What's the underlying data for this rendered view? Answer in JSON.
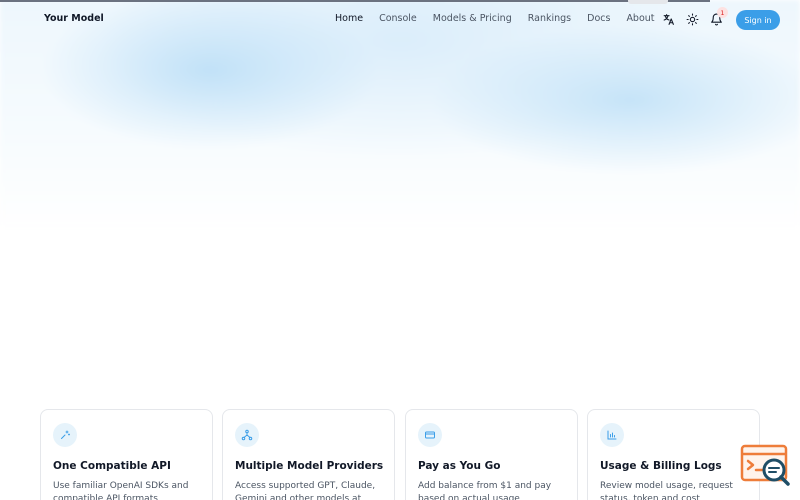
{
  "brand": "Your Model",
  "nav": {
    "items": [
      "Home",
      "Console",
      "Models & Pricing",
      "Rankings",
      "Docs",
      "About"
    ],
    "active": "Home"
  },
  "header": {
    "notification_count": "1",
    "signin_label": "Sign in",
    "icons": [
      "translate-icon",
      "sun-icon",
      "bell-icon"
    ]
  },
  "features": [
    {
      "icon": "sparkles-icon",
      "title": "One Compatible API",
      "desc": "Use familiar OpenAI SDKs and compatible API formats"
    },
    {
      "icon": "network-icon",
      "title": "Multiple Model Providers",
      "desc": "Access supported GPT, Claude, Gemini and other models at"
    },
    {
      "icon": "credit-card-icon",
      "title": "Pay as You Go",
      "desc": "Add balance from $1 and pay based on actual usage"
    },
    {
      "icon": "bar-chart-icon",
      "title": "Usage & Billing Logs",
      "desc": "Review model usage, request status, token and cost"
    }
  ],
  "colors": {
    "accent": "#3b9ee8",
    "icon_bg": "#e6f3fb",
    "badge": "#dc2626",
    "widget": "#ee7d3a"
  }
}
